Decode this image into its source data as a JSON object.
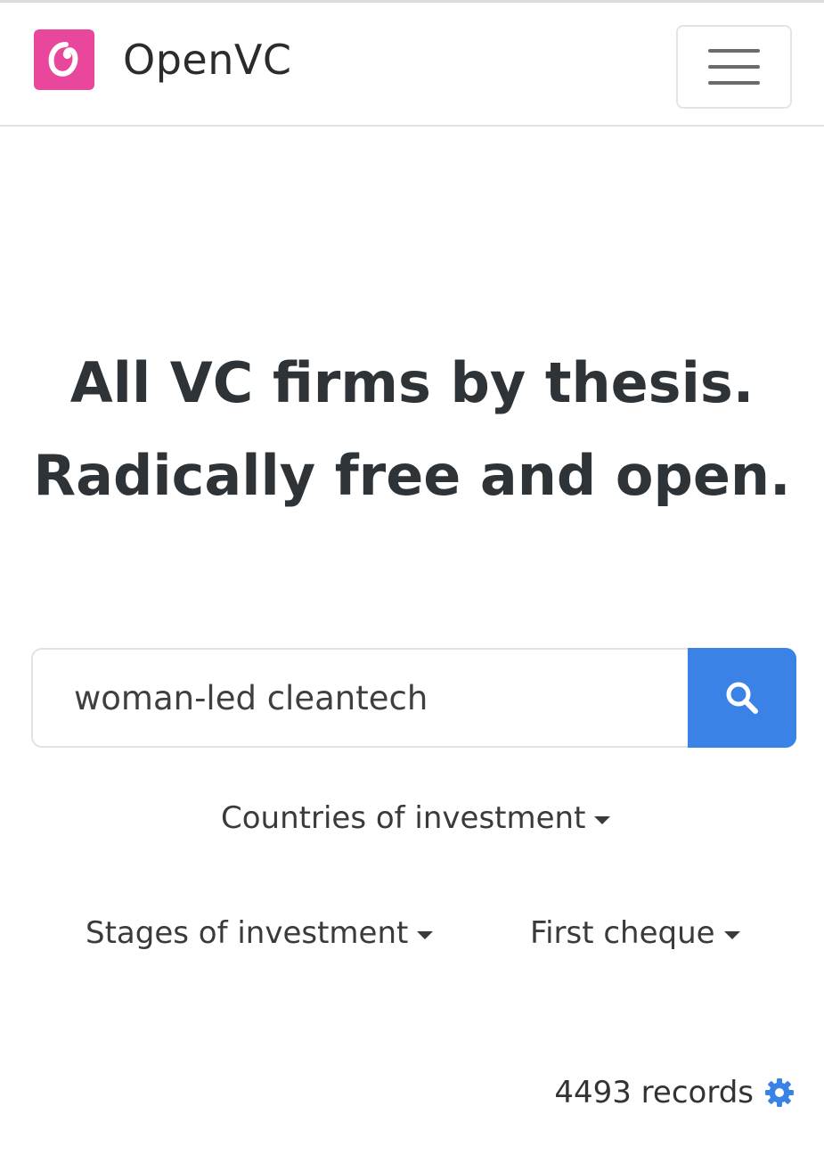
{
  "navbar": {
    "brand_name": "OpenVC",
    "logo_icon": "openvc-logo-icon",
    "menu_icon": "hamburger-menu-icon"
  },
  "hero": {
    "line1": "All VC firms by thesis.",
    "line2": "Radically free and open."
  },
  "search": {
    "value": "woman-led cleantech",
    "button_icon": "search-icon"
  },
  "filters": {
    "countries": "Countries of investment",
    "stages": "Stages of investment",
    "first_cheque": "First cheque"
  },
  "footer": {
    "records": "4493 records",
    "settings_icon": "gear-icon"
  },
  "colors": {
    "brand_pink": "#e8479b",
    "accent_blue": "#3b82e6",
    "text_dark": "#2e3338"
  }
}
